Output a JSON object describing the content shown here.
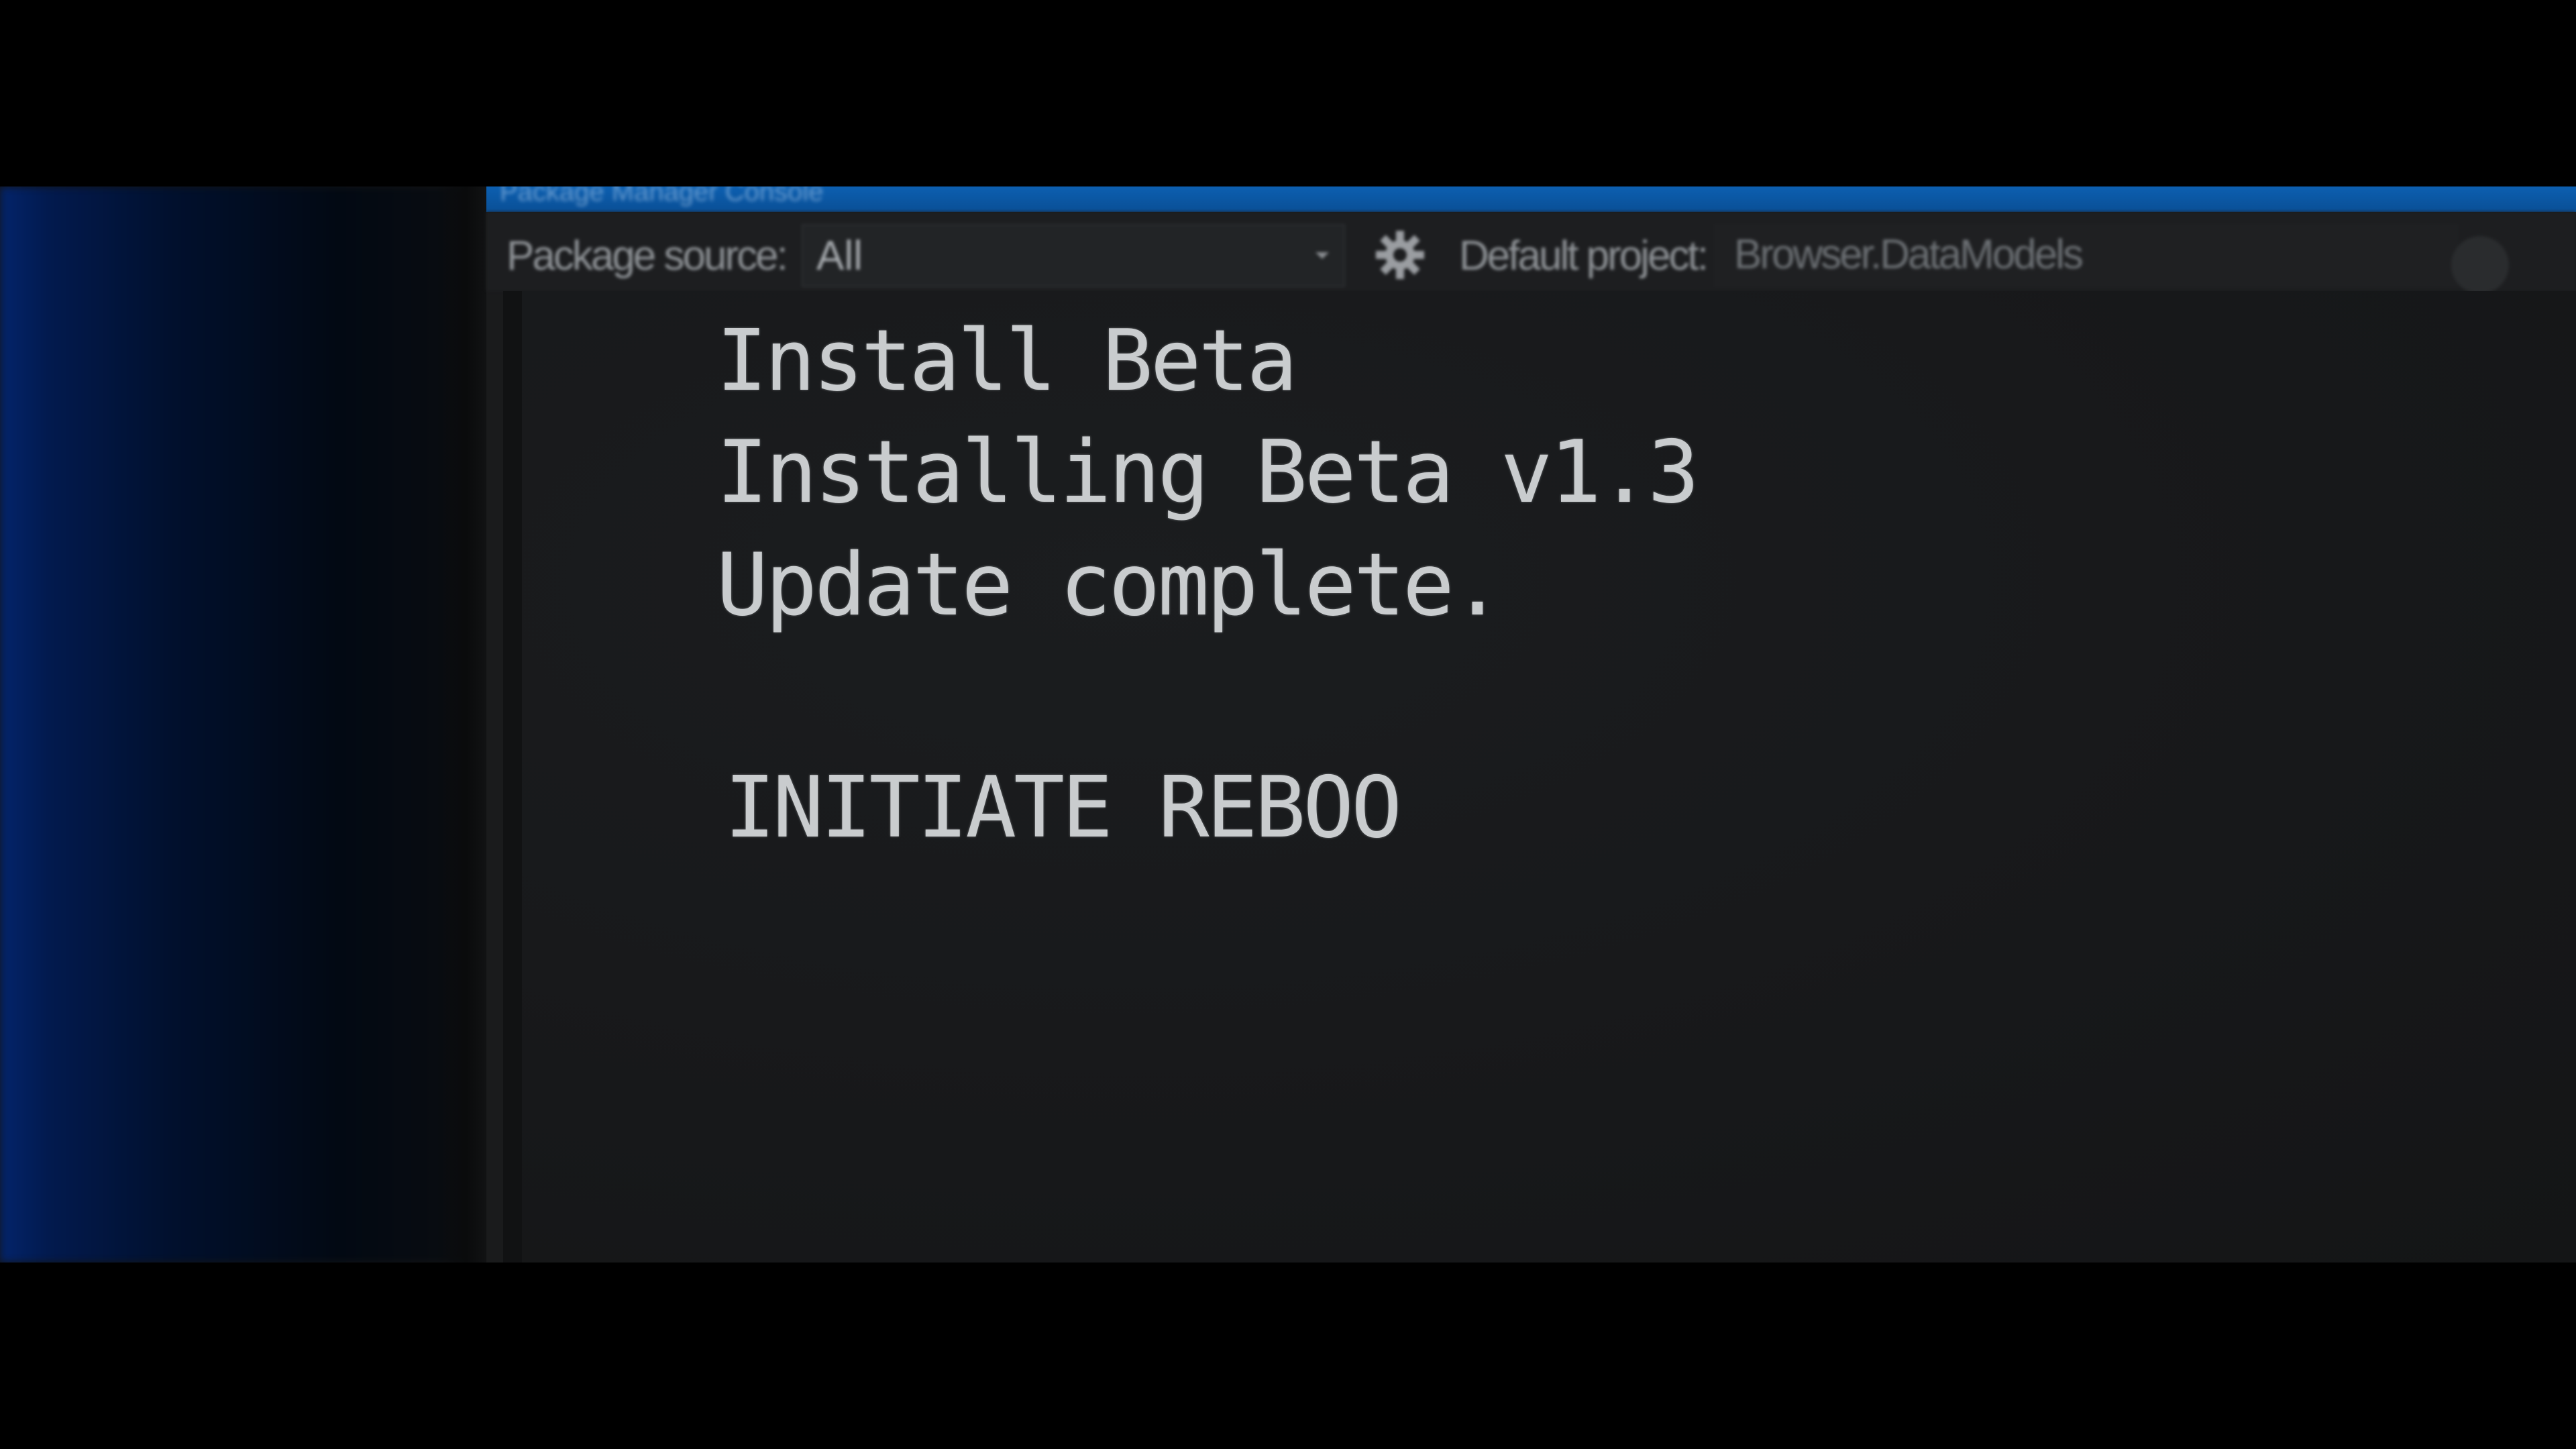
{
  "window": {
    "title": "Package Manager Console"
  },
  "toolbar": {
    "package_source_label": "Package source:",
    "package_source_value": "All",
    "default_project_label": "Default project:",
    "default_project_value": "Browser.DataModels"
  },
  "icons": {
    "settings": "gear-icon",
    "dropdown": "chevron-down-icon",
    "clear": "clear-icon"
  },
  "console": {
    "lines": [
      "Install Beta",
      "Installing Beta v1.3",
      "Update complete.",
      "",
      "INITIATE REBOO"
    ]
  },
  "colors": {
    "title_bar": "#0a4f96",
    "console_background": "#17181a",
    "console_text": "#c9ccce",
    "ambient_glow": "#03246b"
  }
}
